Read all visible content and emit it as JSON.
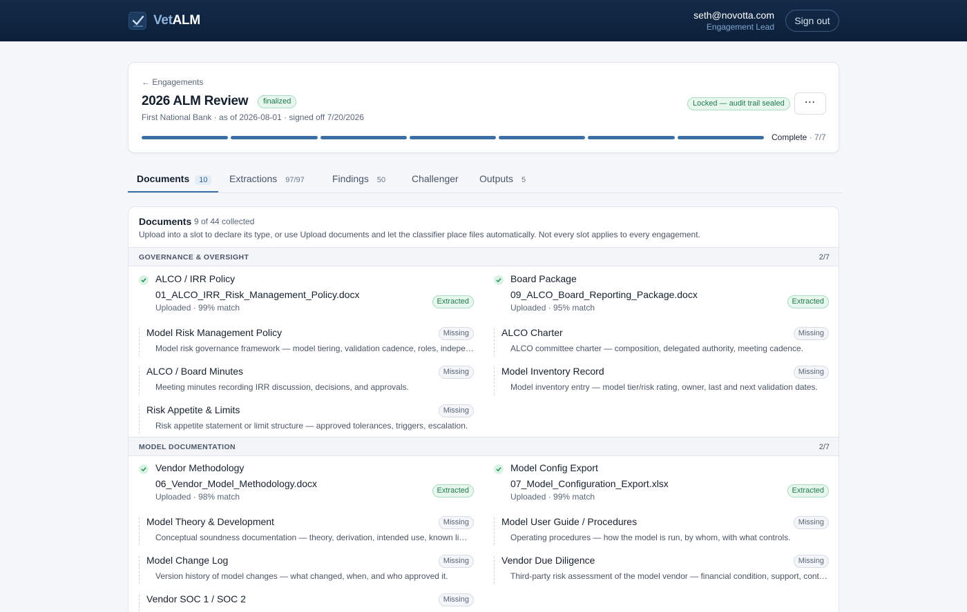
{
  "nav": {
    "brand_vet": "Vet",
    "brand_alm": "ALM",
    "user_email": "seth@novotta.com",
    "user_role": "Engagement Lead",
    "signout": "Sign out"
  },
  "engagement": {
    "back": "← Engagements",
    "title": "2026 ALM Review",
    "status": "finalized",
    "subtitle": "First National Bank · as of 2026-08-01 · signed off 7/20/2026",
    "locked": "Locked — audit trail sealed",
    "more": "⋯",
    "progress_label": "Complete",
    "progress_count": "· 7/7",
    "progress_fraction": 1.0,
    "progress_steps": 7
  },
  "tabs": [
    {
      "label": "Documents",
      "count": "10"
    },
    {
      "label": "Extractions",
      "count": "97/97"
    },
    {
      "label": "Findings",
      "count": "50"
    },
    {
      "label": "Challenger",
      "count": ""
    },
    {
      "label": "Outputs",
      "count": "5"
    }
  ],
  "documents": {
    "title": "Documents",
    "count": "9 of 44 collected",
    "description": "Upload into a slot to declare its type, or use Upload documents and let the classifier place files automatically. Not every slot applies to every engagement.",
    "sections": [
      {
        "name": "GOVERNANCE & OVERSIGHT",
        "ratio": "2/7",
        "slots": [
          {
            "title": "ALCO / IRR Policy",
            "file": "01_ALCO_IRR_Risk_Management_Policy.docx",
            "meta": "Uploaded · 99% match",
            "status": "Extracted"
          },
          {
            "title": "Board Package",
            "file": "09_ALCO_Board_Reporting_Package.docx",
            "meta": "Uploaded · 95% match",
            "status": "Extracted"
          },
          {
            "title": "Model Risk Management Policy",
            "desc": "Model risk governance framework — model tiering, validation cadence, roles, independence requirements.",
            "status": "Missing"
          },
          {
            "title": "ALCO Charter",
            "desc": "ALCO committee charter — composition, delegated authority, meeting cadence.",
            "status": "Missing"
          },
          {
            "title": "ALCO / Board Minutes",
            "desc": "Meeting minutes recording IRR discussion, decisions, and approvals.",
            "status": "Missing"
          },
          {
            "title": "Model Inventory Record",
            "desc": "Model inventory entry — model tier/risk rating, owner, last and next validation dates.",
            "status": "Missing"
          },
          {
            "title": "Risk Appetite & Limits",
            "desc": "Risk appetite statement or limit structure — approved tolerances, triggers, escalation.",
            "status": "Missing"
          }
        ]
      },
      {
        "name": "MODEL DOCUMENTATION",
        "ratio": "2/7",
        "slots": [
          {
            "title": "Vendor Methodology",
            "file": "06_Vendor_Model_Methodology.docx",
            "meta": "Uploaded · 98% match",
            "status": "Extracted"
          },
          {
            "title": "Model Config Export",
            "file": "07_Model_Configuration_Export.xlsx",
            "meta": "Uploaded · 99% match",
            "status": "Extracted"
          },
          {
            "title": "Model Theory & Development",
            "desc": "Conceptual soundness documentation — theory, derivation, intended use, known limitations.",
            "status": "Missing"
          },
          {
            "title": "Model User Guide / Procedures",
            "desc": "Operating procedures — how the model is run, by whom, with what controls.",
            "status": "Missing"
          },
          {
            "title": "Model Change Log",
            "desc": "Version history of model changes — what changed, when, and who approved it.",
            "status": "Missing"
          },
          {
            "title": "Vendor Due Diligence",
            "desc": "Third-party risk assessment of the model vendor — financial condition, support, contract terms.",
            "status": "Missing"
          },
          {
            "title": "Vendor SOC 1 / SOC 2",
            "desc": "",
            "status": "Missing"
          }
        ]
      }
    ]
  }
}
